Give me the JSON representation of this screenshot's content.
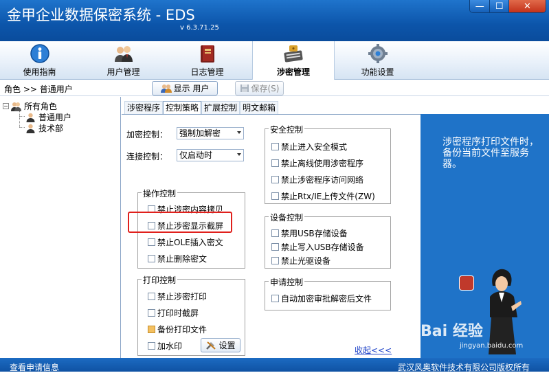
{
  "window": {
    "title": "金甲企业数据保密系统 - EDS",
    "version": "v 6.3.71.25",
    "minimize": "—",
    "maximize": "☐",
    "close": "✕"
  },
  "nav": {
    "tabs": [
      {
        "label": "使用指南",
        "icon": "info-icon"
      },
      {
        "label": "用户管理",
        "icon": "users-icon"
      },
      {
        "label": "日志管理",
        "icon": "log-book-icon"
      },
      {
        "label": "涉密管理",
        "icon": "keyboard-lock-icon",
        "active": true
      },
      {
        "label": "功能设置",
        "icon": "gear-icon"
      }
    ]
  },
  "breadcrumb": "角色 >> 普通用户",
  "toolbar": {
    "show_users": "显示 用户",
    "save": "保存(S)"
  },
  "tree": {
    "root": "所有角色",
    "expander": "−",
    "children": [
      "普通用户",
      "技术部"
    ]
  },
  "tabs": [
    "涉密程序",
    "控制策略",
    "扩展控制",
    "明文邮箱"
  ],
  "form": {
    "encrypt_label": "加密控制：",
    "encrypt_value": "强制加解密",
    "connect_label": "连接控制：",
    "connect_value": "仅启动时"
  },
  "groups": {
    "operation": {
      "title": "操作控制",
      "items": [
        "禁止涉密内容拷贝",
        "禁止涉密显示截屏",
        "禁止OLE插入密文",
        "禁止删除密文"
      ]
    },
    "print": {
      "title": "打印控制",
      "items": [
        "禁止涉密打印",
        "打印时截屏",
        "备份打印文件",
        "加水印"
      ],
      "settings_button": "设置"
    },
    "security": {
      "title": "安全控制",
      "items": [
        "禁止进入安全模式",
        "禁止离线使用涉密程序",
        "禁止涉密程序访问网络",
        "禁止Rtx/IE上传文件(ZW)"
      ]
    },
    "device": {
      "title": "设备控制",
      "items": [
        "禁用USB存储设备",
        "禁止写入USB存储设备",
        "禁止光驱设备"
      ]
    },
    "apply": {
      "title": "申请控制",
      "items": [
        "自动加密审批解密后文件"
      ]
    }
  },
  "collapse_link": "收起<<<",
  "side_panel": {
    "text": "涉密程序打印文件时，备份当前文件至服务器。",
    "watermark": "Bai 经验",
    "watermark_url": "jingyan.baidu.com"
  },
  "status": {
    "left": "查看申请信息",
    "right": "武汉风奥软件技术有限公司版权所有"
  },
  "colors": {
    "title_blue": "#0c55aa",
    "panel_blue": "#1f73c8",
    "highlight_red": "#e0201c",
    "link_blue": "#1a3fc7"
  }
}
